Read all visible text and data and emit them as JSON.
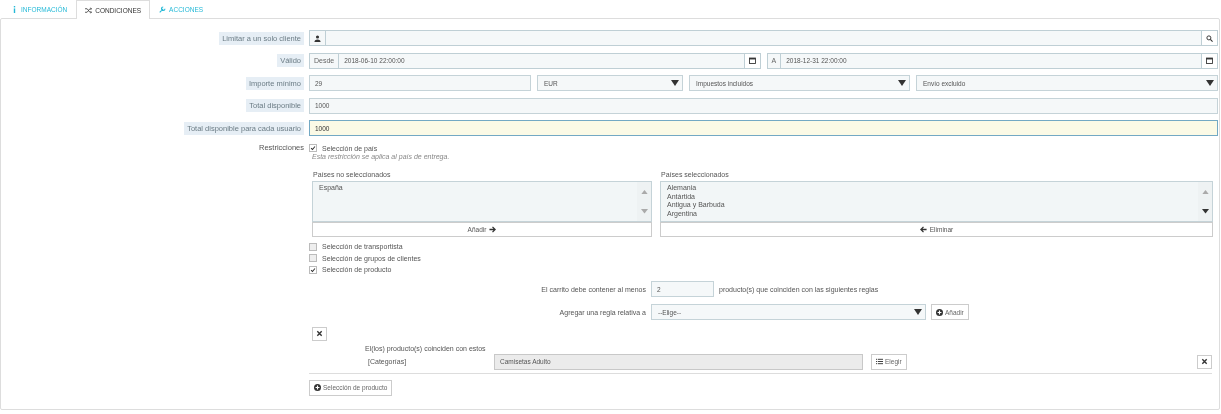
{
  "tabs": [
    {
      "label": "INFORMACIÓN",
      "selected": false
    },
    {
      "label": "CONDICIONES",
      "selected": true
    },
    {
      "label": "ACCIONES",
      "selected": false
    }
  ],
  "customer": {
    "label": "Limitar a un solo cliente"
  },
  "valid": {
    "label": "Válido",
    "from_prefix": "Desde",
    "from": "2018-06-10 22:00:00",
    "to_prefix": "A",
    "to": "2018-12-31 22:00:00"
  },
  "minimum": {
    "label": "Importe mínimo",
    "value": "29",
    "currency": "EUR",
    "taxes": "Impuestos incluidos",
    "shipping": "Envío excluido"
  },
  "total_available": {
    "label": "Total disponible",
    "value": "1000"
  },
  "total_per_user": {
    "label": "Total disponible para cada usuario",
    "value": "1000",
    "focused": true
  },
  "restrictions": {
    "label": "Restricciones",
    "options": [
      {
        "label": "Selección de país",
        "checked": true
      },
      {
        "label": "Selección de transportista",
        "checked": false
      },
      {
        "label": "Selección de grupos de clientes",
        "checked": false
      },
      {
        "label": "Selección de producto",
        "checked": true
      }
    ]
  },
  "country_selection": {
    "hint": "Esta restricción se aplica al país de entrega.",
    "unselected_label": "Países no seleccionados",
    "unselected": [
      "España"
    ],
    "add_button": "Añadir",
    "selected_label": "Países seleccionados",
    "selected": [
      "Alemania",
      "Antártida",
      "Antigua y Barbuda",
      "Argentina"
    ],
    "remove_button": "Eliminar"
  },
  "product_rules": {
    "min_prefix": "El carrito debe contener al menos",
    "min_value": "2",
    "min_suffix": "producto(s) que coinciden con las siguientes reglas",
    "add_rule_label": "Agregar una regla relativa a",
    "add_rule_select": "--Elige--",
    "add_rule_button": "Añadir",
    "rule": {
      "title": "El(los) producto(s) coinciden con estos",
      "type": "[Categorías]",
      "value": "Camisetas Adulto",
      "choose_button": "Elegir"
    },
    "new_group_button": "Selección de producto"
  }
}
